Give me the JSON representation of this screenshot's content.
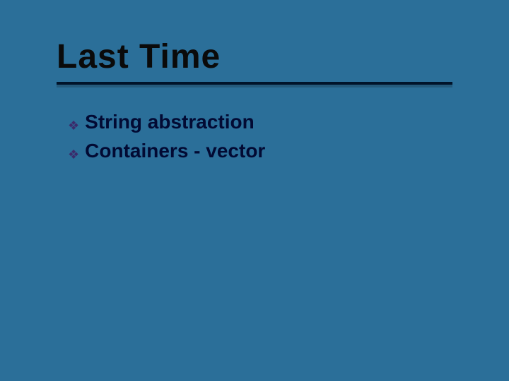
{
  "title": "Last Time",
  "bullets": [
    {
      "icon": "❖",
      "text": "String abstraction"
    },
    {
      "icon": "❖",
      "text": "Containers - vector"
    }
  ]
}
